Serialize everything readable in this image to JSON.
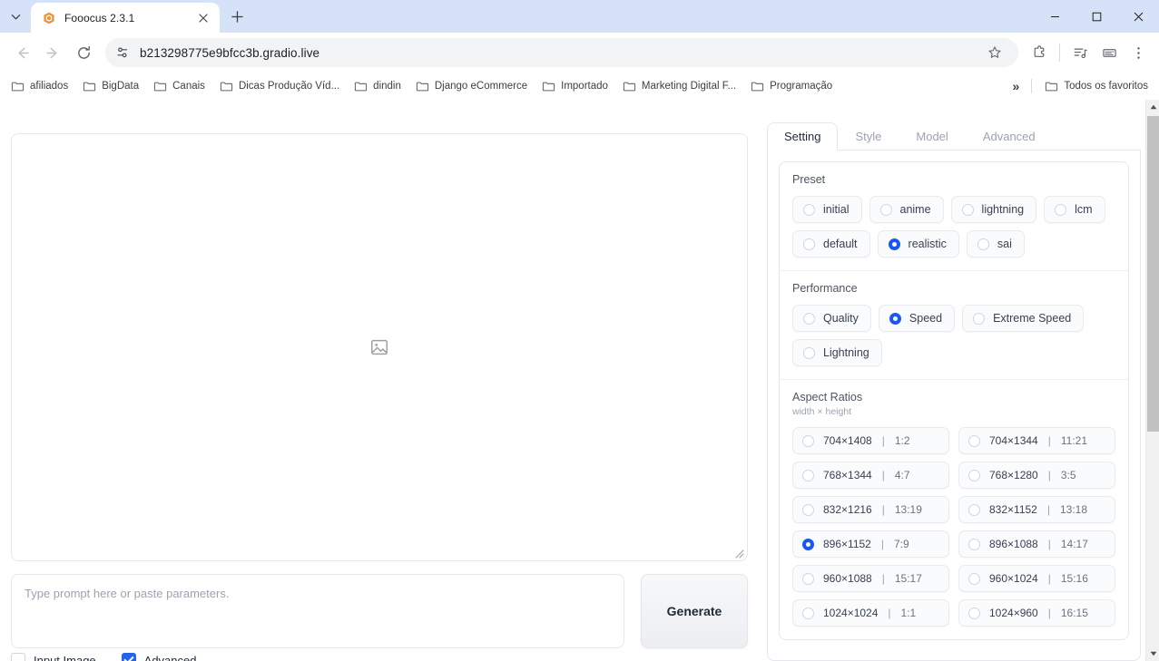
{
  "browser": {
    "tab": {
      "title": "Fooocus 2.3.1",
      "favicon": "fooocus-logo-icon"
    },
    "newtab_tooltip": "New tab",
    "window_controls": {
      "minimize": "minimize-icon",
      "maximize": "maximize-icon",
      "close": "close-icon"
    },
    "nav": {
      "back": "back-arrow-icon",
      "forward": "forward-arrow-icon",
      "reload": "reload-icon"
    },
    "omnibox": {
      "url": "b213298775e9bfcc3b.gradio.live",
      "site_icon": "site-settings-icon",
      "star": "bookmark-star-icon"
    },
    "toolbar_icons": [
      "extensions-puzzle-icon",
      "reading-list-icon",
      "browser-essentials-icon",
      "chrome-menu-icon"
    ],
    "bookmarks": [
      {
        "label": "afiliados"
      },
      {
        "label": "BigData"
      },
      {
        "label": "Canais"
      },
      {
        "label": "Dicas Produção Víd..."
      },
      {
        "label": "dindin"
      },
      {
        "label": "Django eCommerce"
      },
      {
        "label": "Importado"
      },
      {
        "label": "Marketing Digital F..."
      },
      {
        "label": "Programação"
      }
    ],
    "bookmarks_overflow": "»",
    "bookmarks_all": "Todos os favoritos"
  },
  "app": {
    "gallery": {
      "placeholder_icon": "image-placeholder-icon",
      "resize_handle": "resize-grip-icon"
    },
    "prompt": {
      "placeholder": "Type prompt here or paste parameters.",
      "value": ""
    },
    "generate_button": "Generate",
    "checkboxes": [
      {
        "label": "Input Image",
        "checked": false
      },
      {
        "label": "Advanced",
        "checked": true
      }
    ],
    "tabs": [
      {
        "label": "Setting",
        "active": true
      },
      {
        "label": "Style",
        "active": false
      },
      {
        "label": "Model",
        "active": false
      },
      {
        "label": "Advanced",
        "active": false
      }
    ],
    "preset": {
      "title": "Preset",
      "options": [
        {
          "label": "initial",
          "selected": false
        },
        {
          "label": "anime",
          "selected": false
        },
        {
          "label": "lightning",
          "selected": false
        },
        {
          "label": "lcm",
          "selected": false
        },
        {
          "label": "default",
          "selected": false
        },
        {
          "label": "realistic",
          "selected": true
        },
        {
          "label": "sai",
          "selected": false
        }
      ]
    },
    "performance": {
      "title": "Performance",
      "options": [
        {
          "label": "Quality",
          "selected": false
        },
        {
          "label": "Speed",
          "selected": true
        },
        {
          "label": "Extreme Speed",
          "selected": false
        },
        {
          "label": "Lightning",
          "selected": false
        }
      ]
    },
    "aspect_ratios": {
      "title": "Aspect Ratios",
      "subtitle": "width × height",
      "options": [
        {
          "size": "704×1408",
          "ratio": "1:2",
          "selected": false
        },
        {
          "size": "704×1344",
          "ratio": "11:21",
          "selected": false
        },
        {
          "size": "768×1344",
          "ratio": "4:7",
          "selected": false
        },
        {
          "size": "768×1280",
          "ratio": "3:5",
          "selected": false
        },
        {
          "size": "832×1216",
          "ratio": "13:19",
          "selected": false
        },
        {
          "size": "832×1152",
          "ratio": "13:18",
          "selected": false
        },
        {
          "size": "896×1152",
          "ratio": "7:9",
          "selected": true
        },
        {
          "size": "896×1088",
          "ratio": "14:17",
          "selected": false
        },
        {
          "size": "960×1088",
          "ratio": "15:17",
          "selected": false
        },
        {
          "size": "960×1024",
          "ratio": "15:16",
          "selected": false
        },
        {
          "size": "1024×1024",
          "ratio": "1:1",
          "selected": false
        },
        {
          "size": "1024×960",
          "ratio": "16:15",
          "selected": false
        }
      ]
    }
  },
  "colors": {
    "accent_blue": "#1a56f0",
    "titlebar": "#d6e2f7",
    "tab_active": "#ffffff"
  }
}
